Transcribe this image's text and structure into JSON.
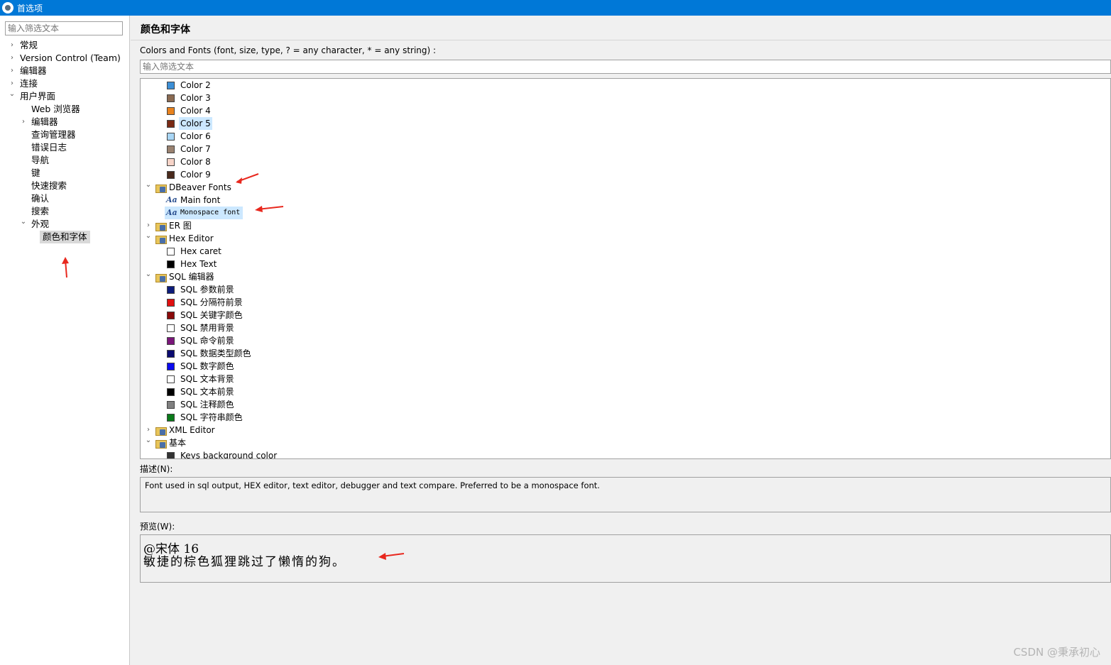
{
  "window": {
    "title": "首选项"
  },
  "left_filter": {
    "placeholder": "输入筛选文本"
  },
  "nav": {
    "items": [
      {
        "label": "常规",
        "level": 0,
        "expander": "collapsed"
      },
      {
        "label": "Version Control (Team)",
        "level": 0,
        "expander": "collapsed"
      },
      {
        "label": "编辑器",
        "level": 0,
        "expander": "collapsed"
      },
      {
        "label": "连接",
        "level": 0,
        "expander": "collapsed"
      },
      {
        "label": "用户界面",
        "level": 0,
        "expander": "expanded"
      },
      {
        "label": "Web 浏览器",
        "level": 1,
        "expander": "none"
      },
      {
        "label": "编辑器",
        "level": 1,
        "expander": "collapsed"
      },
      {
        "label": "查询管理器",
        "level": 1,
        "expander": "none"
      },
      {
        "label": "错误日志",
        "level": 1,
        "expander": "none"
      },
      {
        "label": "导航",
        "level": 1,
        "expander": "none"
      },
      {
        "label": "键",
        "level": 1,
        "expander": "none"
      },
      {
        "label": "快速搜索",
        "level": 1,
        "expander": "none"
      },
      {
        "label": "确认",
        "level": 1,
        "expander": "none"
      },
      {
        "label": "搜索",
        "level": 1,
        "expander": "none"
      },
      {
        "label": "外观",
        "level": 1,
        "expander": "expanded"
      },
      {
        "label": "颜色和字体",
        "level": 2,
        "expander": "none",
        "selected": true
      }
    ]
  },
  "page": {
    "title": "颜色和字体",
    "colors_fonts_label": "Colors and Fonts (font, size, type, ? = any character, * = any string) :",
    "tree_filter_placeholder": "输入筛选文本"
  },
  "tree": {
    "rows": [
      {
        "kind": "color",
        "label": "Color 2",
        "color": "#3c8fd6"
      },
      {
        "kind": "color",
        "label": "Color 3",
        "color": "#8a6a52"
      },
      {
        "kind": "color",
        "label": "Color 4",
        "color": "#e8821e"
      },
      {
        "kind": "color",
        "label": "Color 5",
        "color": "#7a2a14",
        "selected": true
      },
      {
        "kind": "color",
        "label": "Color 6",
        "color": "#a9d6f5"
      },
      {
        "kind": "color",
        "label": "Color 7",
        "color": "#9a8270"
      },
      {
        "kind": "color",
        "label": "Color 8",
        "color": "#f7d4c8"
      },
      {
        "kind": "color",
        "label": "Color 9",
        "color": "#4a2a1c"
      },
      {
        "kind": "category",
        "label": "DBeaver Fonts",
        "expander": "expanded"
      },
      {
        "kind": "font",
        "label": "Main font",
        "icon_text": "Aa"
      },
      {
        "kind": "font",
        "label": "Monospace font",
        "icon_text": "Aa",
        "selected": true,
        "mono": true
      },
      {
        "kind": "category",
        "label": "ER 图",
        "expander": "collapsed"
      },
      {
        "kind": "category",
        "label": "Hex Editor",
        "expander": "expanded"
      },
      {
        "kind": "color",
        "label": "Hex caret",
        "color": "#ffffff"
      },
      {
        "kind": "color",
        "label": "Hex Text",
        "color": "#000000"
      },
      {
        "kind": "category",
        "label": "SQL 编辑器",
        "expander": "expanded"
      },
      {
        "kind": "color",
        "label": "SQL 参数前景",
        "color": "#0c1c7a"
      },
      {
        "kind": "color",
        "label": "SQL 分隔符前景",
        "color": "#e01010"
      },
      {
        "kind": "color",
        "label": "SQL 关键字颜色",
        "color": "#8a0a0a"
      },
      {
        "kind": "color",
        "label": "SQL 禁用背景",
        "color": "#ffffff"
      },
      {
        "kind": "color",
        "label": "SQL 命令前景",
        "color": "#7a167a"
      },
      {
        "kind": "color",
        "label": "SQL 数据类型颜色",
        "color": "#0a0a70"
      },
      {
        "kind": "color",
        "label": "SQL 数字颜色",
        "color": "#0a0af0"
      },
      {
        "kind": "color",
        "label": "SQL 文本背景",
        "color": "#ffffff"
      },
      {
        "kind": "color",
        "label": "SQL 文本前景",
        "color": "#000000"
      },
      {
        "kind": "color",
        "label": "SQL 注释颜色",
        "color": "#808080"
      },
      {
        "kind": "color",
        "label": "SQL 字符串颜色",
        "color": "#0a7a1a"
      },
      {
        "kind": "category",
        "label": "XML Editor",
        "expander": "collapsed"
      },
      {
        "kind": "category",
        "label": "基本",
        "expander": "expanded"
      },
      {
        "kind": "color",
        "label": "Keys background color",
        "color": "#333333"
      }
    ]
  },
  "description": {
    "label": "描述(N):",
    "text": "Font used in sql output, HEX editor, text editor, debugger and text compare. Preferred to be a monospace font."
  },
  "preview": {
    "label": "预览(W):",
    "line1": "@宋体  16",
    "line2": "敏捷的棕色狐狸跳过了懒惰的狗。"
  },
  "watermark": "CSDN @秉承初心",
  "accent_color": "#0078d7",
  "annotation_color": "#e8281e"
}
